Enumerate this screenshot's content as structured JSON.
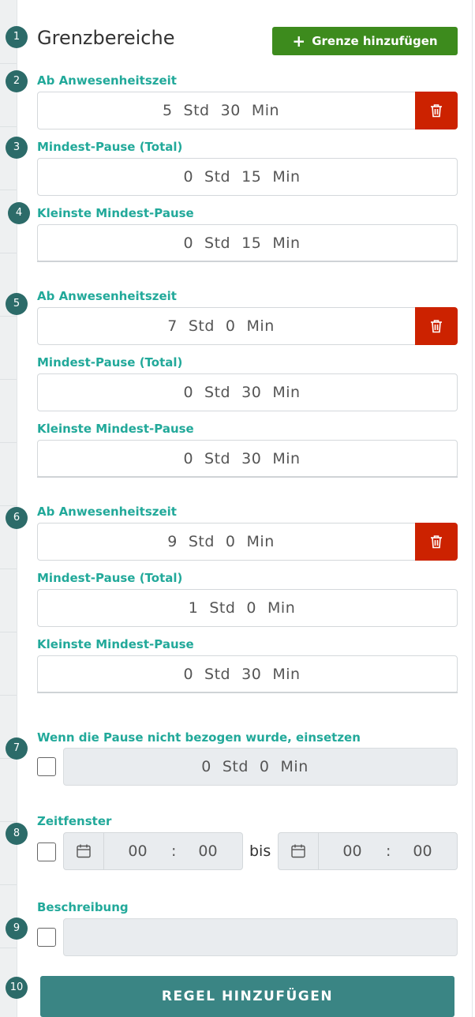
{
  "header": {
    "title": "Grenzbereiche",
    "add_limit_label": "Grenze hinzufügen"
  },
  "badges": [
    "1",
    "2",
    "3",
    "4",
    "5",
    "6",
    "7",
    "8",
    "9",
    "10"
  ],
  "units": {
    "hours": "Std",
    "minutes": "Min"
  },
  "limits": [
    {
      "presence_label": "Ab Anwesenheitszeit",
      "presence_h": "5",
      "presence_m": "30",
      "total_label": "Mindest-Pause (Total)",
      "total_h": "0",
      "total_m": "15",
      "smallest_label": "Kleinste Mindest-Pause",
      "smallest_h": "0",
      "smallest_m": "15"
    },
    {
      "presence_label": "Ab Anwesenheitszeit",
      "presence_h": "7",
      "presence_m": "0",
      "total_label": "Mindest-Pause (Total)",
      "total_h": "0",
      "total_m": "30",
      "smallest_label": "Kleinste Mindest-Pause",
      "smallest_h": "0",
      "smallest_m": "30"
    },
    {
      "presence_label": "Ab Anwesenheitszeit",
      "presence_h": "9",
      "presence_m": "0",
      "total_label": "Mindest-Pause (Total)",
      "total_h": "1",
      "total_m": "0",
      "smallest_label": "Kleinste Mindest-Pause",
      "smallest_h": "0",
      "smallest_m": "30"
    }
  ],
  "fallback": {
    "label": "Wenn die Pause nicht bezogen wurde, einsetzen",
    "hours": "0",
    "minutes": "0"
  },
  "time_window": {
    "label": "Zeitfenster",
    "from_h": "00",
    "from_m": "00",
    "separator": ":",
    "bis_label": "bis",
    "to_h": "00",
    "to_m": "00"
  },
  "description": {
    "label": "Beschreibung",
    "value": ""
  },
  "submit_label": "REGEL HINZUFÜGEN",
  "colors": {
    "accent_teal": "#22a99a",
    "add_button_green": "#3d8b1d",
    "delete_red": "#cc2200",
    "submit_teal": "#3a8584",
    "badge": "#2c6b69"
  }
}
